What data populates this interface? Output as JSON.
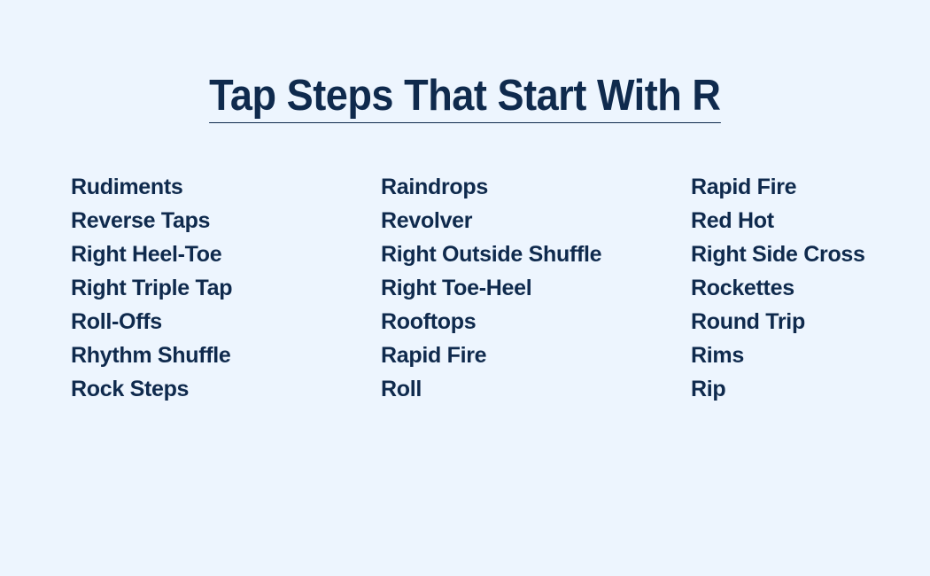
{
  "page": {
    "title": "Tap Steps That Start With R",
    "colors": {
      "background": "#edf5fe",
      "text": "#0f2a4d"
    }
  },
  "columns": [
    {
      "items": [
        "Rudiments",
        "Reverse Taps",
        "Right Heel-Toe",
        "Right Triple Tap",
        "Roll-Offs",
        "Rhythm Shuffle",
        "Rock Steps"
      ]
    },
    {
      "items": [
        "Raindrops",
        "Revolver",
        "Right Outside Shuffle",
        "Right Toe-Heel",
        "Rooftops",
        "Rapid Fire",
        "Roll"
      ]
    },
    {
      "items": [
        "Rapid Fire",
        "Red Hot",
        "Right Side Cross",
        "Rockettes",
        "Round Trip",
        "Rims",
        "Rip"
      ]
    }
  ]
}
